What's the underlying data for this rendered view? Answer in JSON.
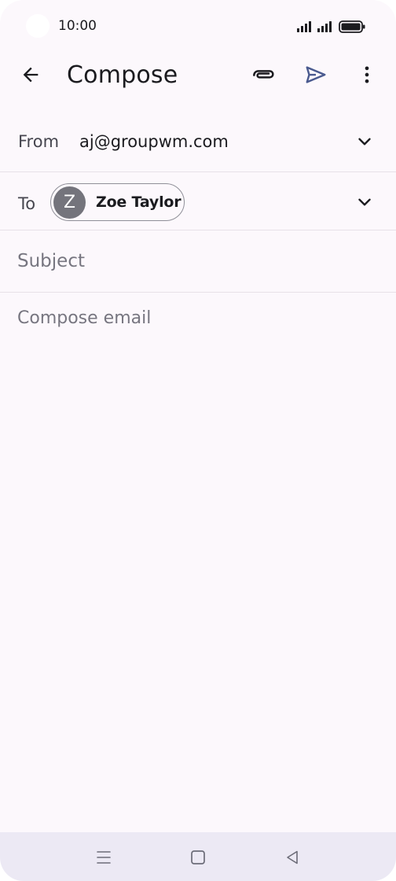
{
  "status_bar": {
    "time": "10:00"
  },
  "app_bar": {
    "title": "Compose",
    "icons": [
      "back-arrow-icon",
      "attach-icon",
      "send-icon",
      "more-vert-icon"
    ]
  },
  "from_row": {
    "label": "From",
    "value": "aj@groupwm.com"
  },
  "to_row": {
    "label": "To",
    "recipient": {
      "initial": "Z",
      "name": "Zoe Taylor"
    }
  },
  "subject": {
    "placeholder": "Subject"
  },
  "body": {
    "placeholder": "Compose email"
  },
  "colors": {
    "background": "#fcf8fc",
    "send_accent": "#4a5a8f",
    "avatar": "#74747c",
    "nav_bar": "#ece9f4"
  }
}
